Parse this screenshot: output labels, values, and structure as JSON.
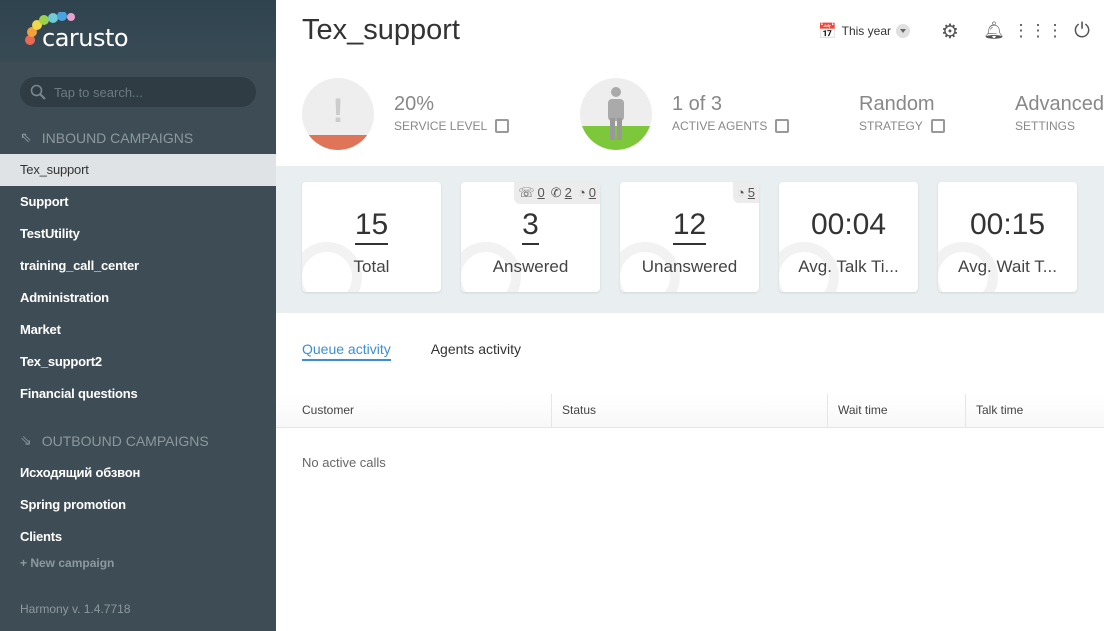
{
  "app": {
    "logo_text": "carusto",
    "version": "Harmony v. 1.4.7718"
  },
  "sidebar": {
    "search_placeholder": "Tap to search...",
    "inbound_title": "INBOUND CAMPAIGNS",
    "inbound": [
      "Tex_support",
      "Support",
      "TestUtility",
      "training_call_center",
      "Administration",
      "Market",
      "Tex_support2",
      "Financial questions"
    ],
    "outbound_title": "OUTBOUND CAMPAIGNS",
    "outbound": [
      "Исходящий обзвон",
      "Spring promotion",
      "Clients"
    ],
    "new_campaign": "New campaign"
  },
  "header": {
    "title": "Tex_support",
    "period": "This year"
  },
  "stats": {
    "service_level": {
      "value": "20%",
      "label": "SERVICE LEVEL",
      "color": "#e07458"
    },
    "agents": {
      "value": "1 of 3",
      "label": "ACTIVE AGENTS",
      "color": "#7dc83a"
    },
    "strategy": {
      "value": "Random",
      "label": "STRATEGY"
    },
    "settings": {
      "value": "Advanced",
      "label": "SETTINGS"
    }
  },
  "cards": [
    {
      "value": "15",
      "label": "Total"
    },
    {
      "value": "3",
      "label": "Answered",
      "badges": [
        "0",
        "2",
        "0"
      ]
    },
    {
      "value": "12",
      "label": "Unanswered",
      "badges": [
        "5"
      ]
    },
    {
      "value": "00:04",
      "label": "Avg. Talk Ti..."
    },
    {
      "value": "00:15",
      "label": "Avg. Wait T..."
    }
  ],
  "tabs": [
    "Queue activity",
    "Agents activity"
  ],
  "table": {
    "columns": [
      "Customer",
      "Status",
      "Wait time",
      "Talk time"
    ],
    "empty": "No active calls"
  }
}
